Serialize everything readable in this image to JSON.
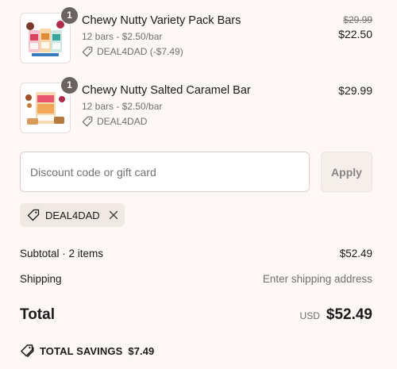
{
  "cart": {
    "items": [
      {
        "title": "Chewy Nutty Variety Pack Bars",
        "quantity": "1",
        "subtitle": "12 bars - $2.50/bar",
        "discount": "DEAL4DAD (-$7.49)",
        "original_price": "$29.99",
        "price": "$22.50"
      },
      {
        "title": "Chewy Nutty Salted Caramel Bar",
        "quantity": "1",
        "subtitle": "12 bars - $2.50/bar",
        "discount": "DEAL4DAD",
        "price": "$29.99"
      }
    ]
  },
  "discount": {
    "placeholder": "Discount code or gift card",
    "apply_label": "Apply",
    "applied_code": "DEAL4DAD"
  },
  "summary": {
    "subtotal_label": "Subtotal · 2 items",
    "subtotal_value": "$52.49",
    "shipping_label": "Shipping",
    "shipping_value": "Enter shipping address",
    "total_label": "Total",
    "currency": "USD",
    "total_value": "$52.49",
    "savings_label": "TOTAL SAVINGS",
    "savings_value": "$7.49"
  },
  "icons": {
    "tag": "tag-icon",
    "close": "close-icon",
    "savings": "double-tag-icon"
  }
}
